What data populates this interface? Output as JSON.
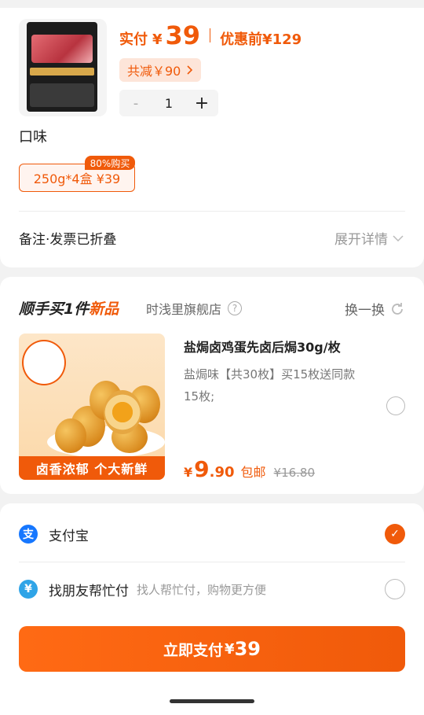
{
  "order": {
    "pay_label": "实付",
    "pay_currency": "¥",
    "pay_amount": "39",
    "original_price": "优惠前¥129",
    "discount_text": "共减￥90",
    "quantity": "1",
    "minus": "-",
    "plus": "+"
  },
  "flavor": {
    "title": "口味",
    "option": "250g*4盒  ¥39",
    "badge": "80%购买"
  },
  "remark": {
    "label": "备注·发票已折叠",
    "expand": "展开详情"
  },
  "upsell": {
    "title_prefix": "顺手买1件",
    "title_highlight": "新品",
    "store": "时浅里旗舰店",
    "help": "?",
    "swap": "换一换",
    "product_name": "盐焗卤鸡蛋先卤后焗30g/枚",
    "product_desc": "盐焗味【共30枚】买15枚送同款15枚;",
    "image_label": "卤香浓郁 个大新鲜",
    "price_currency": "¥",
    "price_int": "9",
    "price_dec": ".90",
    "shipping": "包邮",
    "was_price": "¥16.80"
  },
  "payment": {
    "alipay": "支付宝",
    "friend_pay": "找朋友帮忙付",
    "friend_hint": "找人帮忙付，购物更方便",
    "button_label": "立即支付",
    "button_currency": "¥",
    "button_amount": "39"
  },
  "colors": {
    "accent": "#f05a0a",
    "alipay_blue": "#1677ff",
    "friend_blue": "#2fa4e7"
  }
}
